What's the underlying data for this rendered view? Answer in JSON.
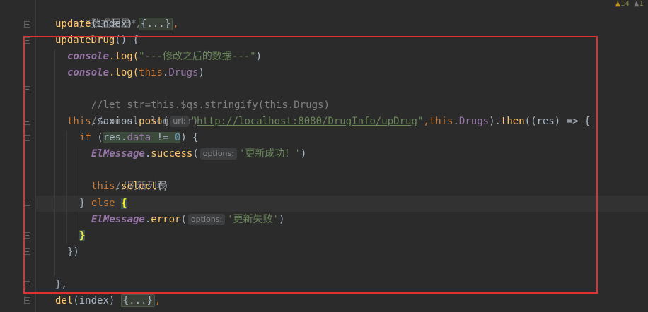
{
  "status": {
    "warnings": "14",
    "weak_warnings": "1"
  },
  "lines": {
    "l1": "/*数据回显*/",
    "l2_fn": "update",
    "l2_args": "(index) ",
    "l2_collapsed": "{...}",
    "l2_tail": ",",
    "l3_fn": "updateDrug",
    "l3_tail": "() {",
    "l4_obj": "console",
    "l4_fn": ".log(",
    "l4_str": "\"---修改之后的数据---\"",
    "l4_tail": ")",
    "l5_obj": "console",
    "l5_fn": ".log(",
    "l5_this": "this",
    "l5_dot": ".",
    "l5_prop": "Drugs",
    "l5_tail": ")",
    "l6": "//let str=this.$qs.stringify(this.Drugs)",
    "l7": "//console.log(str)",
    "l8_this": "this",
    "l8_mid": ".$axios.",
    "l8_fn": "post",
    "l8_paren": "(",
    "l8_hint": "url:",
    "l8_q1": "\"",
    "l8_url": "http://localhost:8080/DrugInfo/upDrug",
    "l8_q2": "\"",
    "l8_comma": ",",
    "l8_this2": "this",
    "l8_dot": ".",
    "l8_prop": "Drugs",
    "l8_then_pre": ").",
    "l8_then": "then",
    "l8_tail": "((res) => {",
    "l9_if": "if",
    "l9_paren": " (",
    "l9_res": "res",
    "l9_dot": ".",
    "l9_data": "data",
    "l9_op": " != ",
    "l9_zero": "0",
    "l9_tail": ") {",
    "l10_cls": "ElMessage",
    "l10_dot": ".",
    "l10_fn": "success",
    "l10_paren": "(",
    "l10_hint": "options:",
    "l10_str": "'更新成功！'",
    "l10_tail": ")",
    "l11": "//刷新列表",
    "l12_this": "this",
    "l12_dot": ".",
    "l12_fn": "select",
    "l12_tail": "()",
    "l13_close": "} ",
    "l13_else": "else",
    "l13_sp": " ",
    "l13_brace": "{",
    "l14_cls": "ElMessage",
    "l14_dot": ".",
    "l14_fn": "error",
    "l14_paren": "(",
    "l14_hint": "options:",
    "l14_str": "'更新失败'",
    "l14_tail": ")",
    "l15_brace": "}",
    "l16": "})",
    "l18": "},",
    "l19_fn": "del",
    "l19_args": "(index) ",
    "l19_collapsed": "{...}",
    "l19_tail": ","
  },
  "colors": {
    "background": "#2b2b2b",
    "highlight_box": "#e03030",
    "keyword": "#cc7832",
    "function": "#ffc66d",
    "string": "#6a8759",
    "comment": "#808080",
    "property": "#9876aa"
  }
}
